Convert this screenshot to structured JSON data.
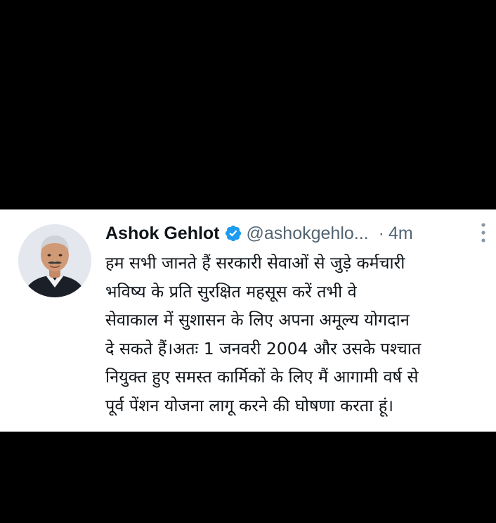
{
  "tweet": {
    "display_name": "Ashok Gehlot",
    "handle": "@ashokgehlo...",
    "separator": "·",
    "time": "4m",
    "verified": true,
    "avatar_icon": "profile-photo",
    "more_icon": "more-vertical-icon",
    "text_lines": [
      "हम सभी जानते हैं सरकारी सेवाओं से जुड़े कर्मचारी",
      "भविष्य के प्रति सुरक्षित महसूस करें तभी वे",
      "सेवाकाल में सुशासन के लिए अपना अमूल्य योगदान",
      "दे सकते हैं।अतः 1 जनवरी 2004 और उसके पश्चात",
      "नियुक्त हुए समस्त कार्मिकों के लिए मैं आगामी वर्ष से",
      "पूर्व पेंशन योजना लागू करने की घोषणा करता हूं।"
    ]
  },
  "colors": {
    "background": "#000000",
    "card": "#ffffff",
    "text": "#0f1419",
    "secondary": "#536471",
    "verified": "#1d9bf0"
  }
}
